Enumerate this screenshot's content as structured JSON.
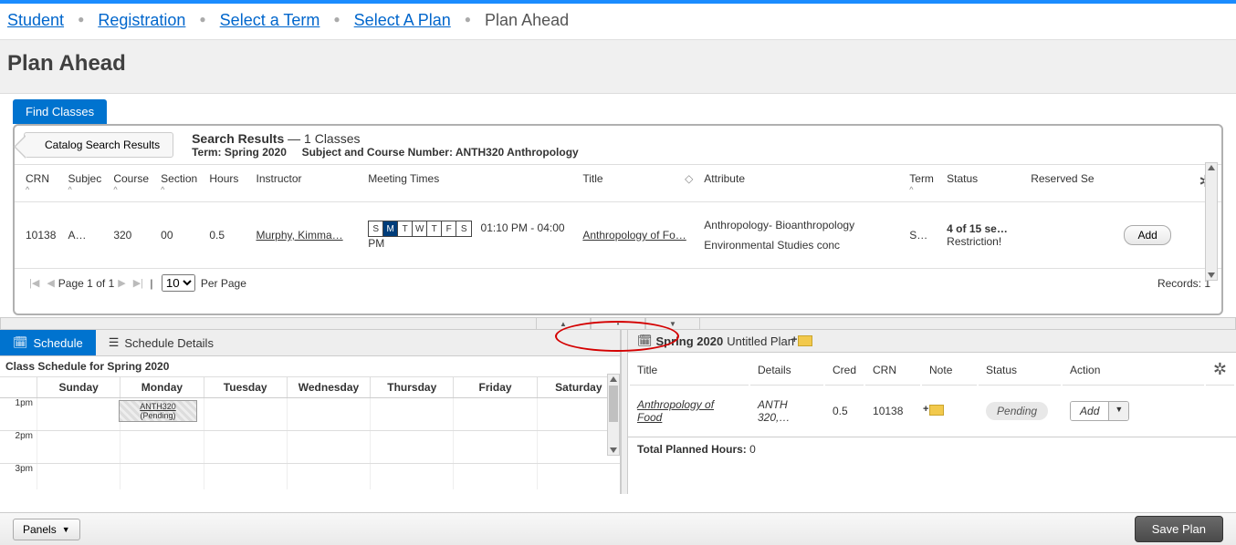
{
  "breadcrumb": {
    "items": [
      "Student",
      "Registration",
      "Select a Term",
      "Select A Plan"
    ],
    "current": "Plan Ahead"
  },
  "page_title": "Plan Ahead",
  "tab": {
    "find_classes": "Find Classes"
  },
  "search_header": {
    "back_btn": "Catalog Search Results",
    "title": "Search Results",
    "count_suffix": " — 1 Classes",
    "term_label": "Term: ",
    "term_value": "Spring 2020",
    "subject_label": "Subject and Course Number: ",
    "subject_value": "ANTH320 Anthropology"
  },
  "cols": {
    "crn": "CRN",
    "subject": "Subjec",
    "course": "Course",
    "section": "Section",
    "hours": "Hours",
    "instructor": "Instructor",
    "meeting": "Meeting Times",
    "title": "Title",
    "attribute": "Attribute",
    "term": "Term",
    "status": "Status",
    "reserved": "Reserved Se"
  },
  "row": {
    "crn": "10138",
    "subject": "A…",
    "course": "320",
    "section": "00",
    "hours": "0.5",
    "instructor": "Murphy, Kimma…",
    "days": [
      "S",
      "M",
      "T",
      "W",
      "T",
      "F",
      "S"
    ],
    "days_on": [
      false,
      true,
      false,
      false,
      false,
      false,
      false
    ],
    "time": "01:10 PM - 04:00 PM",
    "title": "Anthropology of Fo…",
    "attr1": "Anthropology- Bioanthropology",
    "attr2": "Environmental Studies conc",
    "term": "S…",
    "status1": "4 of 15 se…",
    "status2": "Restriction!",
    "add": "Add"
  },
  "pager": {
    "page_label": "Page",
    "page_cur": "1",
    "page_of": "of",
    "page_total": "1",
    "per_page_val": "10",
    "per_page_label": "Per Page",
    "records": "Records: 1"
  },
  "schedule_tabs": {
    "schedule": "Schedule",
    "details": "Schedule Details"
  },
  "schedule_title": "Class Schedule for Spring 2020",
  "days": {
    "sun": "Sunday",
    "mon": "Monday",
    "tue": "Tuesday",
    "wed": "Wednesday",
    "thu": "Thursday",
    "fri": "Friday",
    "sat": "Saturday"
  },
  "times": {
    "t1": "1pm",
    "t2": "2pm",
    "t3": "3pm"
  },
  "event": {
    "code": "ANTH320",
    "status": "(Pending)"
  },
  "plan": {
    "header_term": "Spring 2020",
    "header_name": "Untitled Plan",
    "cols": {
      "title": "Title",
      "details": "Details",
      "credits": "Cred",
      "crn": "CRN",
      "note": "Note",
      "status": "Status",
      "action": "Action"
    },
    "row": {
      "title": "Anthropology of Food",
      "details": "ANTH 320,…",
      "credits": "0.5",
      "crn": "10138",
      "status": "Pending",
      "action": "Add"
    },
    "total_label": "Total Planned Hours: ",
    "total_val": "0"
  },
  "footer": {
    "panels": "Panels",
    "save": "Save Plan"
  }
}
